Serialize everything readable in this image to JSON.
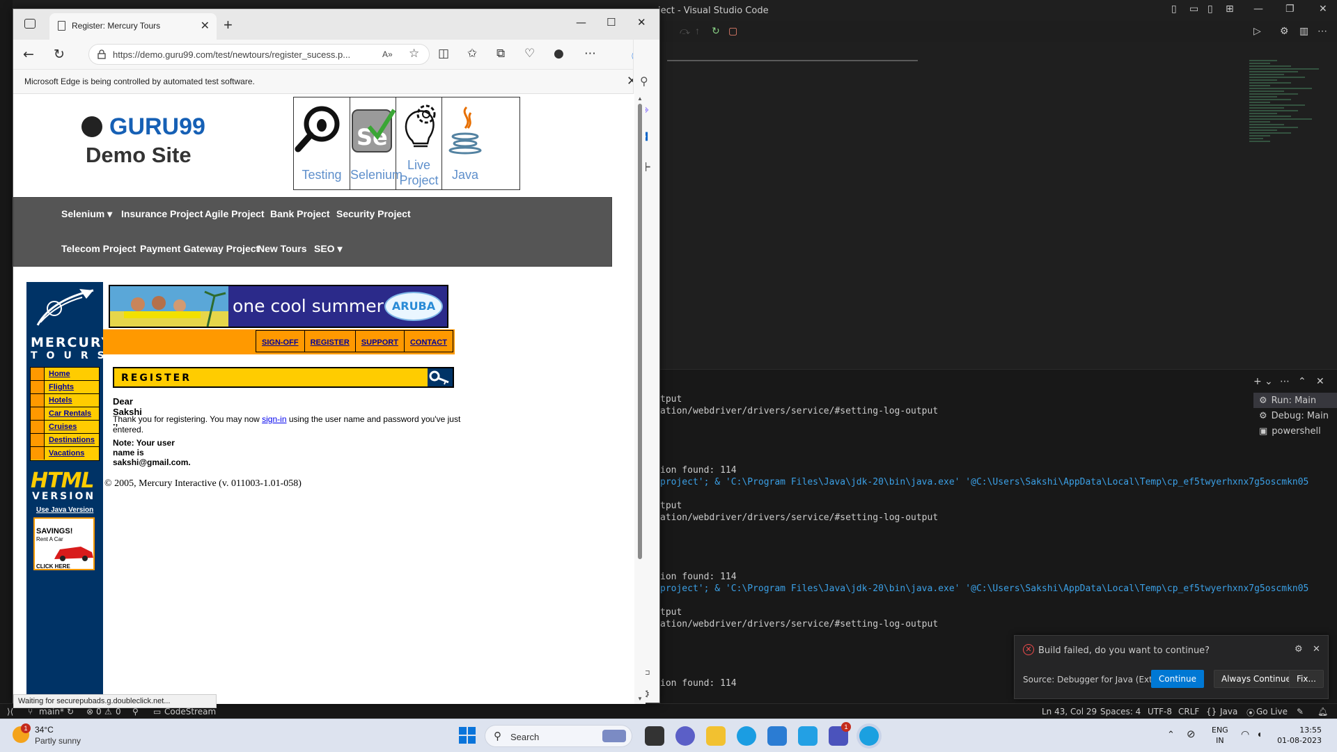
{
  "vscode": {
    "title": "ject - Visual Studio Code",
    "terminal_lines": [
      {
        "text": "tput",
        "blue": false
      },
      {
        "text": "ation/webdriver/drivers/service/#setting-log-output",
        "blue": false
      },
      {
        "text": "ion found: 114",
        "blue": false
      },
      {
        "text": "project'; & 'C:\\Program Files\\Java\\jdk-20\\bin\\java.exe' '@C:\\Users\\Sakshi\\AppData\\Local\\Temp\\cp_ef5twyerhxnx7g5oscmkn05",
        "blue": true
      },
      {
        "text": "tput",
        "blue": false
      },
      {
        "text": "ation/webdriver/drivers/service/#setting-log-output",
        "blue": false
      },
      {
        "text": "ion found: 114",
        "blue": false
      },
      {
        "text": "project'; & 'C:\\Program Files\\Java\\jdk-20\\bin\\java.exe' '@C:\\Users\\Sakshi\\AppData\\Local\\Temp\\cp_ef5twyerhxnx7g5oscmkn05",
        "blue": true
      },
      {
        "text": "tput",
        "blue": false
      },
      {
        "text": "ation/webdriver/drivers/service/#setting-log-output",
        "blue": false
      },
      {
        "text": "ion found: 114",
        "blue": false
      }
    ],
    "terminals": [
      "Run: Main",
      "Debug: Main",
      "powershell"
    ],
    "statusbar": {
      "branch": "main*",
      "problems": "0",
      "warnings": "0",
      "codestream": "CodeStream",
      "position": "Ln 43, Col 29",
      "spaces": "Spaces: 4",
      "encoding": "UTF-8",
      "eol": "CRLF",
      "language": "Java",
      "golive": "Go Live"
    },
    "notification": {
      "message": "Build failed, do you want to continue?",
      "source": "Source: Debugger for Java (Exte...",
      "continue": "Continue",
      "always": "Always Continue",
      "fix": "Fix..."
    }
  },
  "browser": {
    "tab_title": "Register: Mercury Tours",
    "url": "https://demo.guru99.com/test/newtours/register_sucess.p...",
    "infobar": "Microsoft Edge is being controlled by automated test software.",
    "status": "Waiting for securepubads.g.doubleclick.net..."
  },
  "page": {
    "logo_name": "GURU99",
    "logo_sub": "Demo Site",
    "tools": [
      "Testing",
      "Selenium",
      "Live Project",
      "Java"
    ],
    "nav_row1": [
      "Selenium ▾",
      "Insurance Project",
      "Agile Project",
      "Bank Project",
      "Security Project"
    ],
    "nav_row2": [
      "Telecom Project",
      "Payment Gateway Project",
      "New Tours",
      "SEO ▾"
    ]
  },
  "mercury": {
    "brand1": "MERCURY",
    "brand2": "TOURS",
    "menu": [
      "Home",
      "Flights",
      "Hotels",
      "Car Rentals",
      "Cruises",
      "Destinations",
      "Vacations"
    ],
    "html_label": "HTML",
    "version_label": "VERSION",
    "java_link": "Use Java Version",
    "savings_title": "SAVINGS!",
    "savings_sub": "Rent A Car",
    "savings_click": "CLICK HERE",
    "banner_text": "one cool summer",
    "banner_brand": "ARUBA",
    "toplinks": [
      "SIGN-OFF",
      "REGISTER",
      "SUPPORT",
      "CONTACT"
    ],
    "register_heading": "REGISTER",
    "dear": "Dear Sakshi .,",
    "thanks_pre": "Thank you for registering. You may now",
    "thanks_link": "sign-in",
    "thanks_post": "using the user name and password you've just entered.",
    "note": "Note: Your user name is sakshi@gmail.com.",
    "copyright": "© 2005, Mercury Interactive (v. 011003-1.01-058)"
  },
  "taskbar": {
    "temp": "34°C",
    "condition": "Partly sunny",
    "weather_badge": "1",
    "search": "Search",
    "teams_badge": "1",
    "lang1": "ENG",
    "lang2": "IN",
    "time": "13:55",
    "date": "01-08-2023"
  }
}
